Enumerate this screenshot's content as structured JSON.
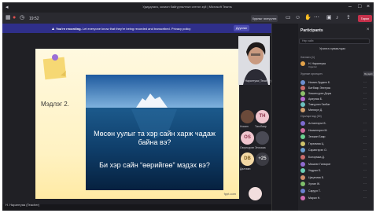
{
  "window": {
    "title": "Удирдлага, зохион байгуулалтын сэтгэл зүй | Microsoft Teams"
  },
  "toolbar": {
    "timer": "19:52",
    "meet_now_label": "Хурлыг эхлүүлэх",
    "leave_label": "Гарах"
  },
  "banner": {
    "strong": "You're recording.",
    "text": "Let everyone know that they're being recorded and transcribed. Privacy policy",
    "button": "Дуусгах"
  },
  "slide": {
    "label": "Мэдлэг 2.",
    "question1": "Мөсөн уулыг та хэр сайн харж чадаж байна вэ?",
    "question2": "Би хэр сайн “өөрийгөө” мэдэх вэ?",
    "footer": "fppt.com"
  },
  "presenter_tile": {
    "name": "Н. Нарантуяа (Teacher)"
  },
  "grid": [
    {
      "initials": "",
      "name": "Номин",
      "color": "#6b4a3a"
    },
    {
      "initials": "TH",
      "name": "Төгсбаяр",
      "color": "#f0c6cf"
    },
    {
      "initials": "OS",
      "name": "Оюунсүрэн",
      "color": "#f0c6cf"
    },
    {
      "initials": "",
      "name": "Энхзаяа",
      "color": "#4a4a55"
    },
    {
      "initials": "DB",
      "name": "Дөлгөөн",
      "color": "#f4d9a5"
    },
    {
      "initials": "",
      "name": "+25",
      "color": "#3b3b43"
    }
  ],
  "stage_footer": "Н. Нарантуяа (Teacher)",
  "panel": {
    "title": "Participants",
    "search_placeholder": "Нэр хайх",
    "share_invite": "Урилга хуваалцах",
    "section_presenters": "Хөтлөгч (1)",
    "section_meeting": "Хурлын оролцогч",
    "mute_all": "Бүгдийг",
    "section_attendees": "Оролцогчид (30)",
    "presenters": [
      {
        "name": "Н. Нарантуяа",
        "role": "Organizer",
        "color": "#e2a24a"
      }
    ],
    "attendees": [
      {
        "name": "Номин-Эрдэнэ Б.",
        "color": "#6b8ecf"
      },
      {
        "name": "Батбаяр Энхтуяа",
        "color": "#c76b6b"
      },
      {
        "name": "Хишигсүрэн Дорж",
        "color": "#8dbf6b"
      },
      {
        "name": "Ариунаа Б.",
        "color": "#b56bcf"
      },
      {
        "name": "Тэмүүлэн Ганбат",
        "color": "#6bc0bf"
      },
      {
        "name": "Мөнхзул Д.",
        "color": "#cf9d6b"
      },
      {
        "name": "Алтангэрэл Б.",
        "color": "#7d6bcf"
      },
      {
        "name": "Номингэрэл М.",
        "color": "#cf6b9d"
      },
      {
        "name": "Энхжин Баяр",
        "color": "#6bcf8f"
      },
      {
        "name": "Гэрэлмаа Ц.",
        "color": "#cfc36b"
      },
      {
        "name": "Сарангэрэл О.",
        "color": "#6b9dcf"
      },
      {
        "name": "Болормаа Д.",
        "color": "#c96b6b"
      },
      {
        "name": "Мишээл Ганзориг",
        "color": "#8f6bcf"
      },
      {
        "name": "Ундрал Б.",
        "color": "#6bcfb4"
      },
      {
        "name": "Цэцэгмаа Б.",
        "color": "#cf8e6b"
      },
      {
        "name": "Хулан Ж.",
        "color": "#7fbf6b"
      },
      {
        "name": "Саруул Т.",
        "color": "#6b7fcf"
      },
      {
        "name": "Марал Н.",
        "color": "#cf6bb0"
      }
    ]
  },
  "colors": {
    "leave": "#c4314b",
    "banner": "#2f2f8a",
    "teams_purple": "#4b4bb0"
  }
}
